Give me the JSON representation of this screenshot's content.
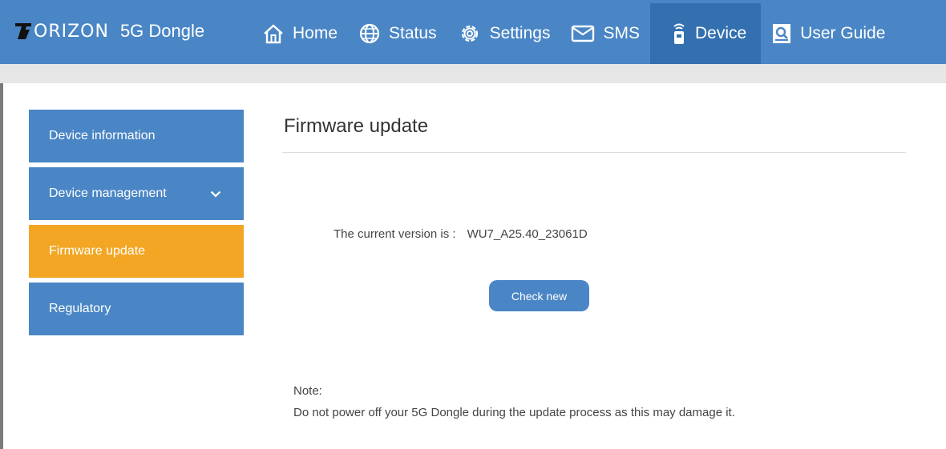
{
  "header": {
    "brand_name": "ORIZON",
    "product": "5G Dongle",
    "nav": [
      {
        "label": "Home",
        "icon": "home-icon"
      },
      {
        "label": "Status",
        "icon": "globe-icon"
      },
      {
        "label": "Settings",
        "icon": "gear-icon"
      },
      {
        "label": "SMS",
        "icon": "envelope-icon"
      },
      {
        "label": "Device",
        "icon": "dongle-icon",
        "active": true
      },
      {
        "label": "User Guide",
        "icon": "guide-icon"
      }
    ]
  },
  "sidebar": {
    "items": [
      {
        "label": "Device information"
      },
      {
        "label": "Device management",
        "icon": "chevron-down-icon"
      },
      {
        "label": "Firmware update",
        "active": true
      },
      {
        "label": "Regulatory"
      }
    ]
  },
  "main": {
    "title": "Firmware update",
    "version_label": "The current version is :",
    "version_value": "WU7_A25.40_23061D",
    "check_button": "Check new",
    "note_label": "Note:",
    "note_text": "Do not power off your 5G Dongle during the update process as this may damage it."
  },
  "colors": {
    "primary": "#4a86c5",
    "active_nav": "#3470b0",
    "active_side": "#f2a623"
  }
}
